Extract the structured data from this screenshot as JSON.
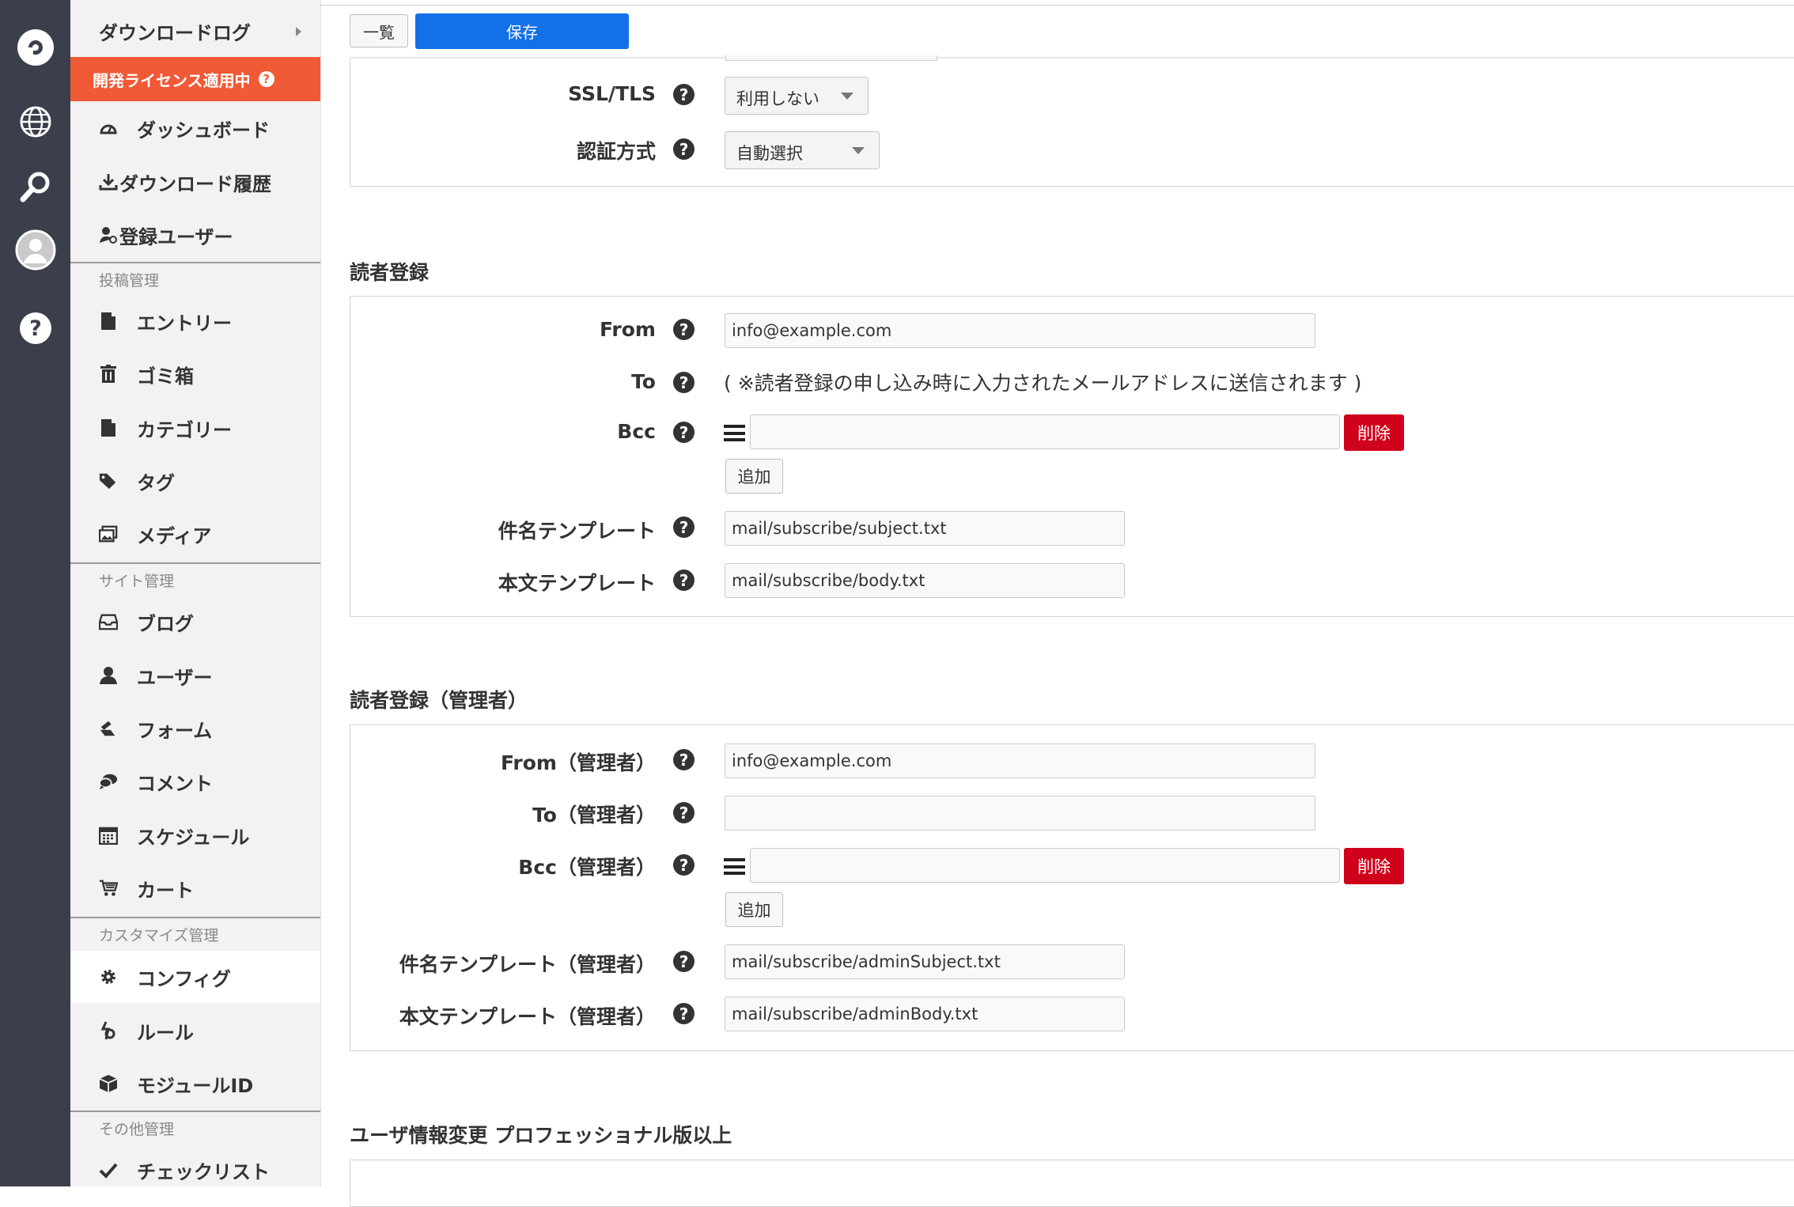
{
  "rail": {
    "icons": [
      "acms-logo-icon",
      "globe-icon",
      "search-icon",
      "avatar",
      "help-icon"
    ]
  },
  "sidebar": {
    "top_item": "ダウンロードログ",
    "dev_license": "開発ライセンス適用中",
    "dev_license_help": "?",
    "items_a": [
      {
        "label": "ダッシュボード",
        "icon": "dashboard-icon"
      },
      {
        "label": "ダウンロード履歴",
        "icon": "download-icon"
      },
      {
        "label": "登録ユーザー",
        "icon": "user-add-icon"
      }
    ],
    "section_post": "投稿管理",
    "items_post": [
      {
        "label": "エントリー",
        "icon": "document-icon"
      },
      {
        "label": "ゴミ箱",
        "icon": "trash-icon"
      },
      {
        "label": "カテゴリー",
        "icon": "folder-icon"
      },
      {
        "label": "タグ",
        "icon": "tag-icon"
      },
      {
        "label": "メディア",
        "icon": "media-icon"
      }
    ],
    "section_site": "サイト管理",
    "items_site": [
      {
        "label": "ブログ",
        "icon": "inbox-icon"
      },
      {
        "label": "ユーザー",
        "icon": "user-icon"
      },
      {
        "label": "フォーム",
        "icon": "form-icon"
      },
      {
        "label": "コメント",
        "icon": "comment-icon"
      },
      {
        "label": "スケジュール",
        "icon": "calendar-icon"
      },
      {
        "label": "カート",
        "icon": "cart-icon"
      }
    ],
    "section_custom": "カスタマイズ管理",
    "items_custom": [
      {
        "label": "コンフィグ",
        "icon": "gear-icon"
      },
      {
        "label": "ルール",
        "icon": "rule-icon"
      },
      {
        "label": "モジュールID",
        "icon": "module-icon"
      }
    ],
    "section_other": "その他管理",
    "items_other": [
      {
        "label": "チェックリスト",
        "icon": "check-icon"
      }
    ]
  },
  "toolbar": {
    "list_label": "一覧",
    "save_label": "保存"
  },
  "mail_settings": {
    "ssl_label": "SSL/TLS",
    "ssl_value": "利用しない",
    "auth_label": "認証方式",
    "auth_value": "自動選択"
  },
  "subscribe": {
    "title": "読者登録",
    "from_label": "From",
    "from_value": "info@example.com",
    "to_label": "To",
    "to_note": "( ※読者登録の申し込み時に入力されたメールアドレスに送信されます )",
    "bcc_label": "Bcc",
    "bcc_value": "",
    "delete_label": "削除",
    "add_label": "追加",
    "subject_label": "件名テンプレート",
    "subject_value": "mail/subscribe/subject.txt",
    "body_label": "本文テンプレート",
    "body_value": "mail/subscribe/body.txt"
  },
  "subscribe_admin": {
    "title": "読者登録（管理者）",
    "from_label": "From（管理者）",
    "from_value": "info@example.com",
    "to_label": "To（管理者）",
    "to_value": "",
    "bcc_label": "Bcc（管理者）",
    "bcc_value": "",
    "delete_label": "削除",
    "add_label": "追加",
    "subject_label": "件名テンプレート（管理者）",
    "subject_value": "mail/subscribe/adminSubject.txt",
    "body_label": "本文テンプレート（管理者）",
    "body_value": "mail/subscribe/adminBody.txt"
  },
  "user_change": {
    "title": "ユーザ情報変更 プロフェッショナル版以上"
  },
  "help_glyph": "?",
  "colors": {
    "rail": "#3b3f4c",
    "sidebar": "#f2f2f2",
    "dev_license": "#f15a36",
    "save_button": "#1470e6",
    "delete_button": "#d0021b"
  }
}
